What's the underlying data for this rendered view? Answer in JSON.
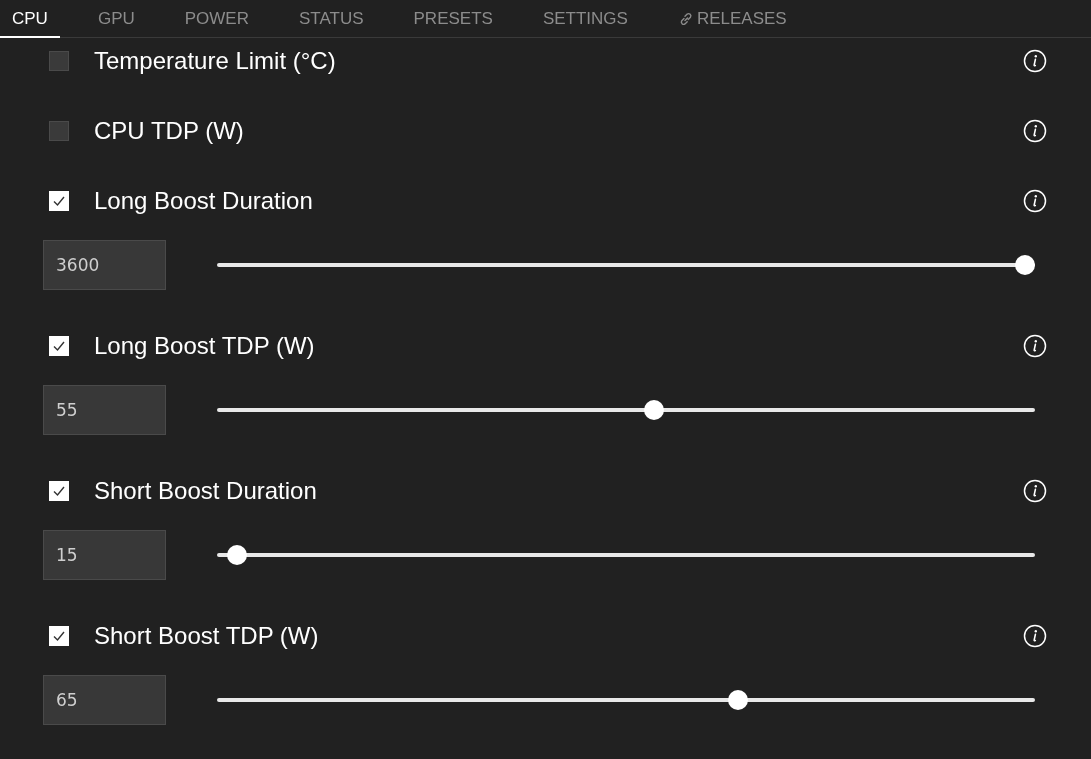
{
  "tabs": [
    {
      "label": "CPU",
      "selected": true,
      "kind": "text"
    },
    {
      "label": "GPU",
      "selected": false,
      "kind": "text"
    },
    {
      "label": "POWER",
      "selected": false,
      "kind": "text"
    },
    {
      "label": "STATUS",
      "selected": false,
      "kind": "text"
    },
    {
      "label": "PRESETS",
      "selected": false,
      "kind": "text"
    },
    {
      "label": "SETTINGS",
      "selected": false,
      "kind": "text"
    },
    {
      "label": "RELEASES",
      "selected": false,
      "kind": "link"
    }
  ],
  "settings": [
    {
      "label": "Temperature Limit (°C)",
      "checked": false
    },
    {
      "label": "CPU TDP (W)",
      "checked": false
    },
    {
      "label": "Long Boost Duration",
      "checked": true,
      "value": "3600",
      "level": 1.0
    },
    {
      "label": "Long Boost TDP (W)",
      "checked": true,
      "value": "55",
      "level": 0.535
    },
    {
      "label": "Short Boost Duration",
      "checked": true,
      "value": "15",
      "level": 0.0125
    },
    {
      "label": "Short Boost TDP (W)",
      "checked": true,
      "value": "65",
      "level": 0.64
    }
  ]
}
